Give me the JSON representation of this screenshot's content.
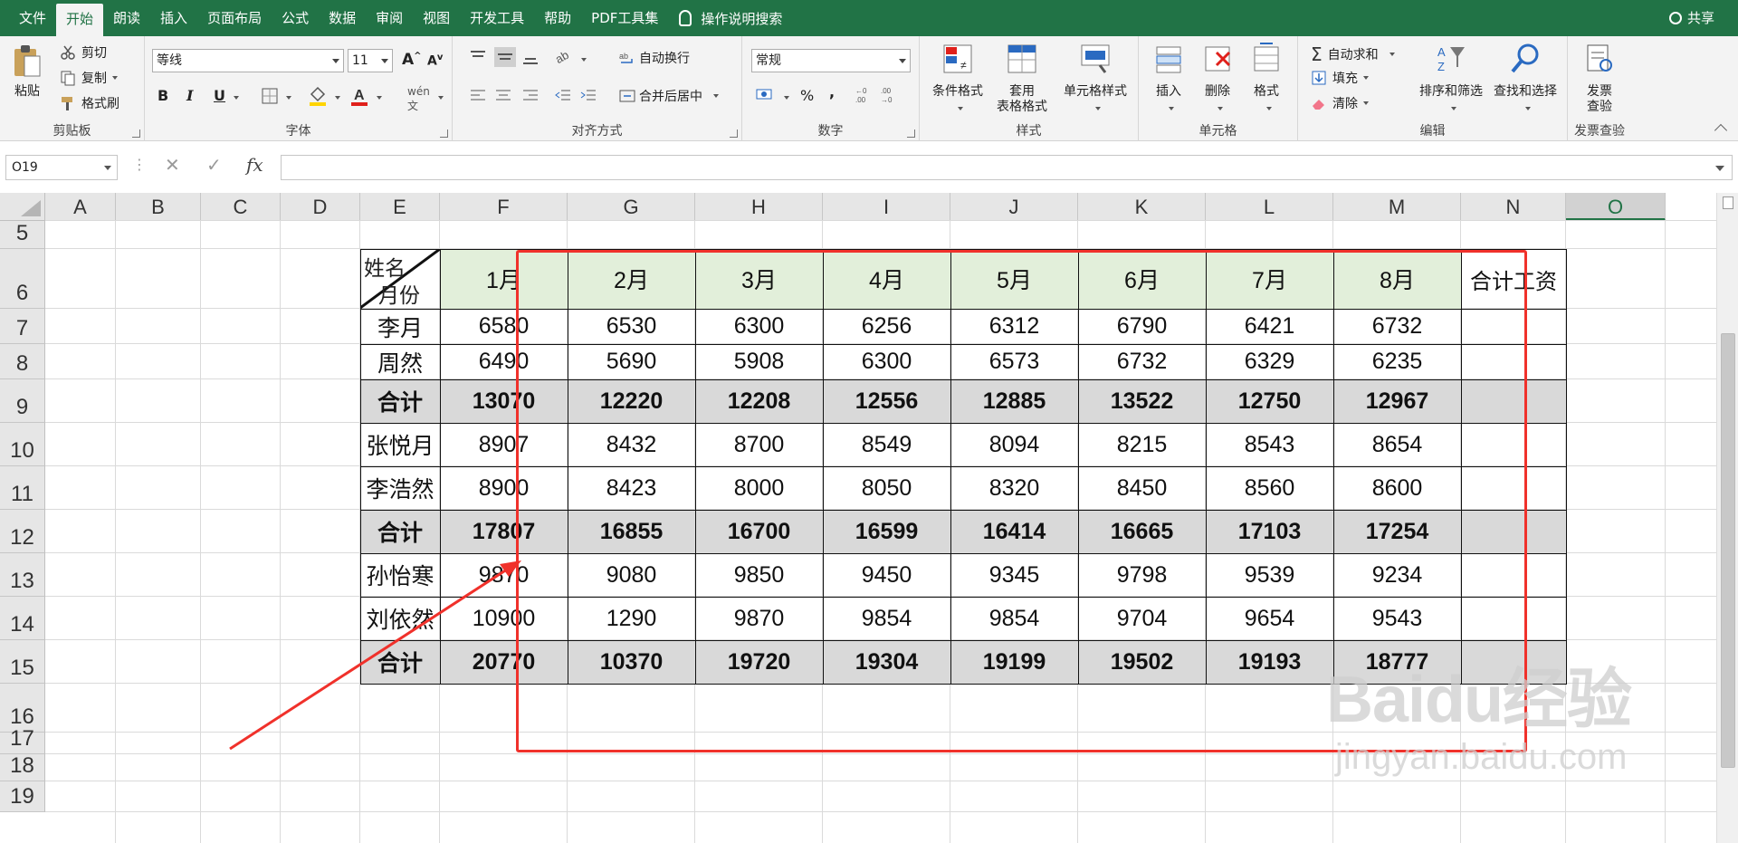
{
  "menubar": {
    "tabs": [
      "文件",
      "开始",
      "朗读",
      "插入",
      "页面布局",
      "公式",
      "数据",
      "审阅",
      "视图",
      "开发工具",
      "帮助",
      "PDF工具集"
    ],
    "tell_me": "操作说明搜索",
    "share": "共享",
    "active_tab": "开始"
  },
  "ribbon": {
    "clipboard": {
      "label": "剪贴板",
      "paste": "粘贴",
      "cut": "剪切",
      "copy": "复制",
      "format_painter": "格式刷"
    },
    "font": {
      "label": "字体",
      "font_name": "等线",
      "font_size": "11",
      "bold": "B",
      "italic": "I",
      "underline": "U"
    },
    "alignment": {
      "label": "对齐方式",
      "wrap_text": "自动换行",
      "merge_center": "合并后居中"
    },
    "number": {
      "label": "数字",
      "format": "常规",
      "percent": "%"
    },
    "styles": {
      "label": "样式",
      "conditional": "条件格式",
      "table_format_1": "套用",
      "table_format_2": "表格格式",
      "cell_styles": "单元格样式"
    },
    "cells": {
      "label": "单元格",
      "insert": "插入",
      "delete": "删除",
      "format": "格式"
    },
    "editing": {
      "label": "编辑",
      "autosum": "自动求和",
      "fill": "填充",
      "clear": "清除",
      "sort_filter": "排序和筛选",
      "find_select": "查找和选择"
    },
    "invoice": {
      "label": "发票查验",
      "btn_1": "发票",
      "btn_2": "查验"
    }
  },
  "formula_bar": {
    "name_box": "O19",
    "fx": "fx",
    "content": ""
  },
  "grid": {
    "columns": [
      "A",
      "B",
      "C",
      "D",
      "E",
      "F",
      "G",
      "H",
      "I",
      "J",
      "K",
      "L",
      "M",
      "N",
      "O"
    ],
    "selected_column": "O",
    "rows": [
      "5",
      "6",
      "7",
      "8",
      "9",
      "10",
      "11",
      "12",
      "13",
      "14",
      "15",
      "16",
      "17",
      "18",
      "19"
    ]
  },
  "table": {
    "header_top": "姓名",
    "header_bottom": "月份",
    "months": [
      "1月",
      "2月",
      "3月",
      "4月",
      "5月",
      "6月",
      "7月",
      "8月"
    ],
    "total_header": "合计工资",
    "rows": [
      {
        "name": "李月",
        "values": [
          "6580",
          "6530",
          "6300",
          "6256",
          "6312",
          "6790",
          "6421",
          "6732"
        ],
        "is_sum": false
      },
      {
        "name": "周然",
        "values": [
          "6490",
          "5690",
          "5908",
          "6300",
          "6573",
          "6732",
          "6329",
          "6235"
        ],
        "is_sum": false
      },
      {
        "name": "合计",
        "values": [
          "13070",
          "12220",
          "12208",
          "12556",
          "12885",
          "13522",
          "12750",
          "12967"
        ],
        "is_sum": true
      },
      {
        "name": "张悦月",
        "values": [
          "8907",
          "8432",
          "8700",
          "8549",
          "8094",
          "8215",
          "8543",
          "8654"
        ],
        "is_sum": false
      },
      {
        "name": "李浩然",
        "values": [
          "8900",
          "8423",
          "8000",
          "8050",
          "8320",
          "8450",
          "8560",
          "8600"
        ],
        "is_sum": false
      },
      {
        "name": "合计",
        "values": [
          "17807",
          "16855",
          "16700",
          "16599",
          "16414",
          "16665",
          "17103",
          "17254"
        ],
        "is_sum": true
      },
      {
        "name": "孙怡寒",
        "values": [
          "9870",
          "9080",
          "9850",
          "9450",
          "9345",
          "9798",
          "9539",
          "9234"
        ],
        "is_sum": false
      },
      {
        "name": "刘依然",
        "values": [
          "10900",
          "1290",
          "9870",
          "9854",
          "9854",
          "9704",
          "9654",
          "9543"
        ],
        "is_sum": false
      },
      {
        "name": "合计",
        "values": [
          "20770",
          "10370",
          "19720",
          "19304",
          "19199",
          "19502",
          "19193",
          "18777"
        ],
        "is_sum": true
      }
    ]
  },
  "watermark": {
    "logo": "Baidu经验",
    "url": "jingyan.baidu.com"
  },
  "colors": {
    "menubar": "#217346",
    "header_fill": "#e2efda",
    "sum_fill": "#d9d9d9",
    "highlight": "#f0312b"
  }
}
